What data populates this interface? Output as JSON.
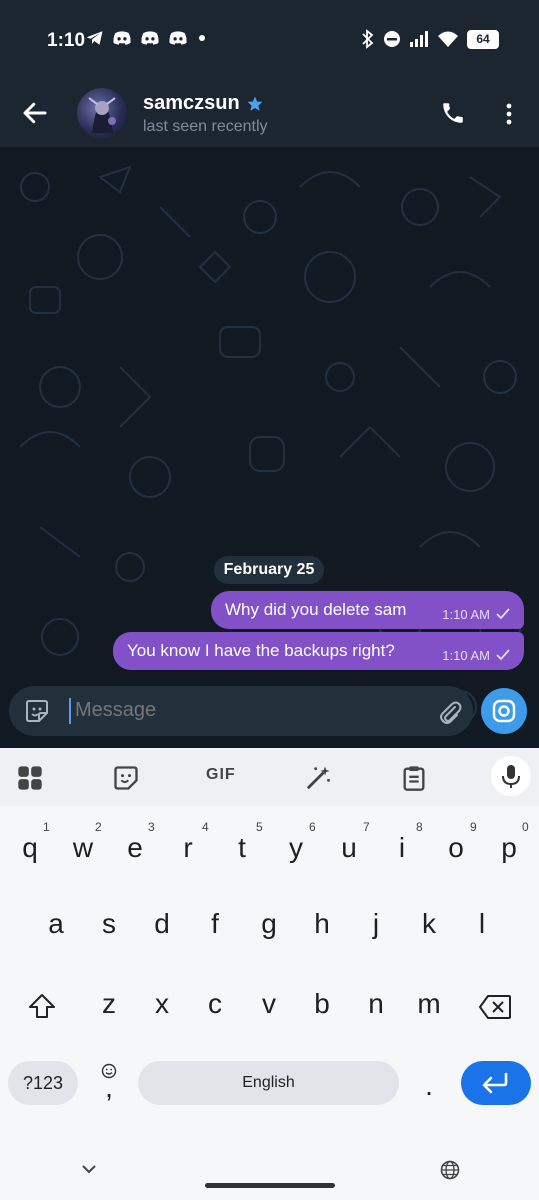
{
  "status_bar": {
    "time": "1:10",
    "battery": "64"
  },
  "header": {
    "contact_name": "samczsun",
    "last_seen": "last seen recently"
  },
  "chat": {
    "date_separator": "February 25",
    "messages": [
      {
        "text": "Why did you delete sam",
        "time": "1:10 AM"
      },
      {
        "text": "You know I have the backups right?",
        "time": "1:10 AM"
      }
    ]
  },
  "composer": {
    "placeholder": "Message"
  },
  "keyboard": {
    "toolbar": {
      "gif_label": "GIF"
    },
    "row1": [
      "q",
      "w",
      "e",
      "r",
      "t",
      "y",
      "u",
      "i",
      "o",
      "p"
    ],
    "row1_hints": [
      "1",
      "2",
      "3",
      "4",
      "5",
      "6",
      "7",
      "8",
      "9",
      "0"
    ],
    "row2": [
      "a",
      "s",
      "d",
      "f",
      "g",
      "h",
      "j",
      "k",
      "l"
    ],
    "row3": [
      "z",
      "x",
      "c",
      "v",
      "b",
      "n",
      "m"
    ],
    "symbols_label": "?123",
    "comma": ",",
    "space_label": "English",
    "period": "."
  },
  "colors": {
    "accent": "#8250c7",
    "send_blue": "#3d9be9",
    "enter_blue": "#1a73e8"
  },
  "icons": [
    "back-arrow-icon",
    "verified-star-icon",
    "phone-icon",
    "more-vert-icon",
    "sticker-icon",
    "attach-icon",
    "camera-icon",
    "mic-icon",
    "shift-icon",
    "backspace-icon",
    "enter-icon",
    "globe-icon",
    "chevron-down-icon",
    "emoji-icon",
    "grid-icon",
    "clipboard-icon",
    "magic-wand-icon",
    "telegram-icon",
    "discord-icon",
    "bluetooth-icon",
    "dnd-icon",
    "signal-icon",
    "wifi-icon",
    "checkmark-icon"
  ]
}
